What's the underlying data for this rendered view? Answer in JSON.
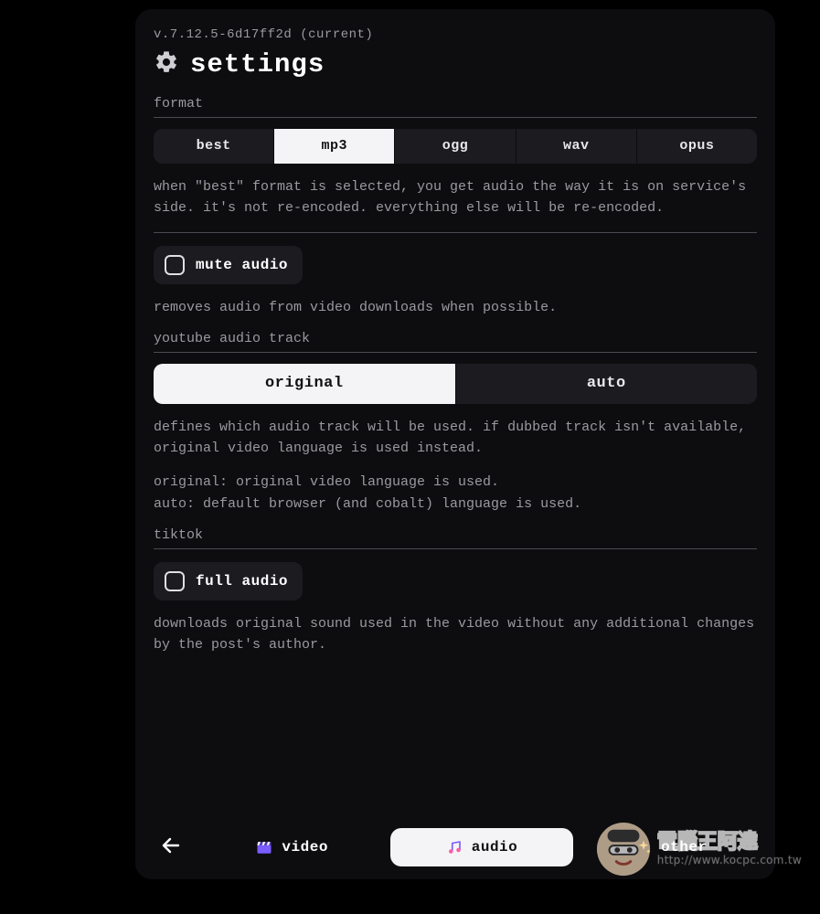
{
  "version": "v.7.12.5-6d17ff2d (current)",
  "title": "settings",
  "format": {
    "label": "format",
    "options": [
      "best",
      "mp3",
      "ogg",
      "wav",
      "opus"
    ],
    "selected_index": 1,
    "description": "when \"best\" format is selected, you get audio the way it is on service's side. it's not re-encoded. everything else will be re-encoded."
  },
  "mute": {
    "label": "mute audio",
    "checked": false,
    "description": "removes audio from video downloads when possible."
  },
  "yt_track": {
    "label": "youtube audio track",
    "options": [
      "original",
      "auto"
    ],
    "selected_index": 0,
    "description": "defines which audio track will be used. if dubbed track isn't available, original video language is used instead.",
    "hint": "original: original video language is used.\nauto: default browser (and cobalt) language is used."
  },
  "tiktok": {
    "label": "tiktok",
    "full_audio": {
      "label": "full audio",
      "checked": false,
      "description": "downloads original sound used in the video without any additional changes by the post's author."
    }
  },
  "tabs": {
    "items": [
      "video",
      "audio",
      "other"
    ],
    "selected_index": 1,
    "icons": [
      "clapper-icon",
      "music-icon",
      "sparkle-icon"
    ]
  },
  "watermark": {
    "title": "電腦王阿達",
    "url": "http://www.kocpc.com.tw"
  }
}
